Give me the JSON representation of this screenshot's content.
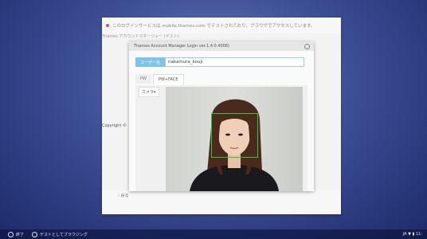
{
  "card": {
    "notice": "このログインサービスは mobile.thames.com でテストされており、ブラウザでアクセスしています。",
    "sub": "Thames アカウントマネージャー (ゲスト)",
    "copyright": "Copyright ©",
    "back": "‹ 戻る"
  },
  "dialog": {
    "title": "Thames Account Manager Login  ver.1.4.0.4006)",
    "user_label": "ユーザー名",
    "user_value": "nakamura_kouji",
    "tabs": [
      "PW",
      "PW+FACE"
    ],
    "camera_button": "カメラ▾"
  },
  "taskbar": {
    "shutdown": "終了",
    "guest_browse": "ゲストとしてブラウジング",
    "status": "JA ▼ ▮ 11:"
  },
  "colors": {
    "accent": "#7ec3ea",
    "face_box": "#35c24a"
  }
}
